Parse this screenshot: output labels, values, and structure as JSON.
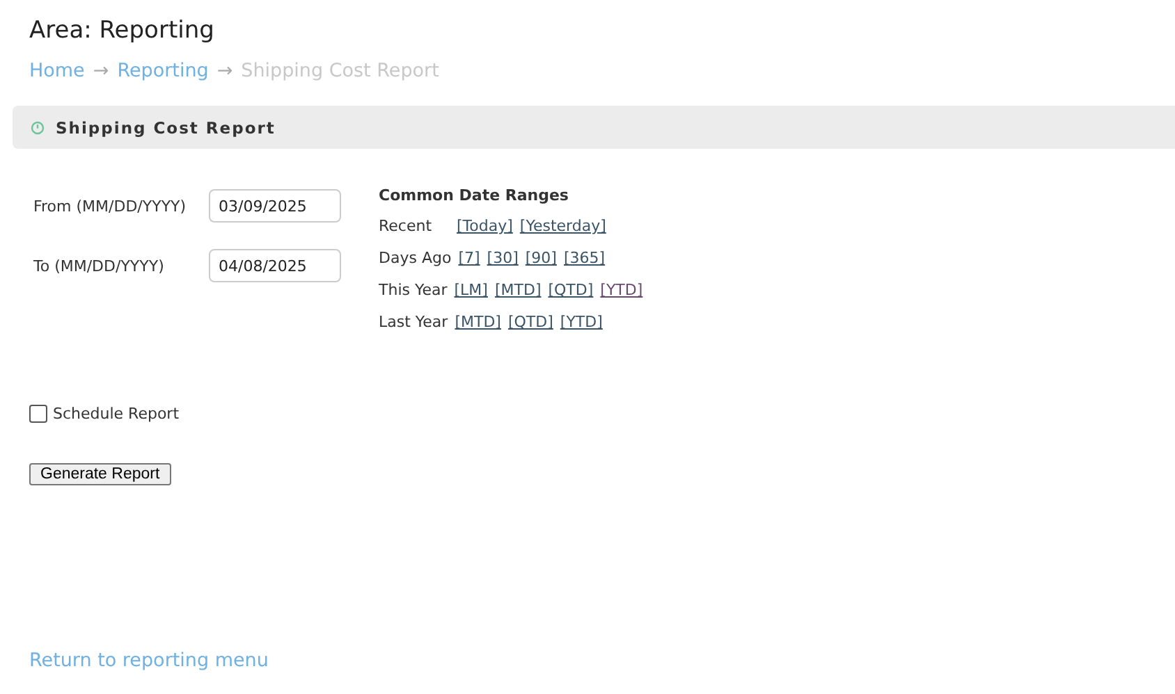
{
  "area_title": "Area: Reporting",
  "breadcrumb": [
    {
      "label": "Home",
      "kind": "link",
      "arrow": "→"
    },
    {
      "label": "Reporting",
      "kind": "link",
      "arrow": "→"
    },
    {
      "label": "Shipping Cost Report",
      "kind": "current"
    }
  ],
  "panel": {
    "title": "Shipping Cost Report"
  },
  "fields": [
    {
      "label": "From (MM/DD/YYYY)",
      "value": "03/09/2025"
    },
    {
      "label": "To (MM/DD/YYYY)",
      "value": "04/08/2025"
    }
  ],
  "date_ranges": {
    "title": "Common Date Ranges",
    "rows": [
      {
        "label": "Recent",
        "links": [
          {
            "label": "[Today]",
            "visited": false
          },
          {
            "label": "[Yesterday]",
            "visited": false
          }
        ]
      },
      {
        "label": "Days Ago",
        "links": [
          {
            "label": "[7]",
            "visited": false
          },
          {
            "label": "[30]",
            "visited": false
          },
          {
            "label": "[90]",
            "visited": false
          },
          {
            "label": "[365]",
            "visited": false
          }
        ]
      },
      {
        "label": "This Year",
        "links": [
          {
            "label": "[LM]",
            "visited": false
          },
          {
            "label": "[MTD]",
            "visited": false
          },
          {
            "label": "[QTD]",
            "visited": false
          },
          {
            "label": "[YTD]",
            "visited": true
          }
        ]
      },
      {
        "label": "Last Year",
        "links": [
          {
            "label": "[MTD]",
            "visited": false
          },
          {
            "label": "[QTD]",
            "visited": false
          },
          {
            "label": "[YTD]",
            "visited": false
          }
        ]
      }
    ]
  },
  "schedule": {
    "label": "Schedule Report",
    "checked": false
  },
  "generate_button": "Generate Report",
  "return_link": "Return to reporting menu"
}
